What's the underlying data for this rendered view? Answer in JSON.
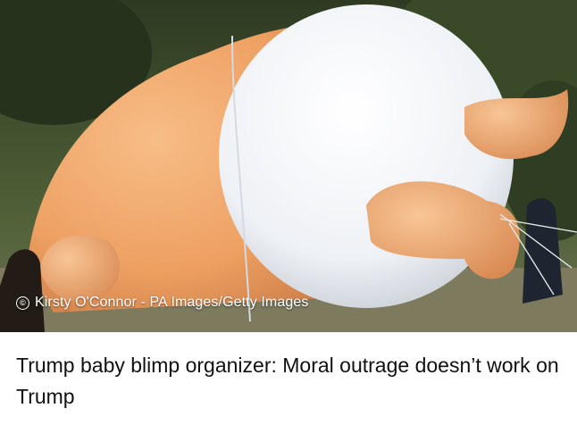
{
  "article": {
    "image_alt": "Inflatable orange baby blimp with white diaper being held by people outdoors",
    "credit_icon": "copyright-icon",
    "credit": "Kirsty O'Connor - PA Images/Getty Images",
    "headline": "Trump baby blimp organizer: Moral outrage doesn’t work on Trump"
  },
  "colors": {
    "balloon_skin": "#f2a768",
    "diaper": "#f4f6f8",
    "foliage": "#3c4a2c",
    "headline_text": "#111111",
    "credit_text": "#ffffff"
  }
}
